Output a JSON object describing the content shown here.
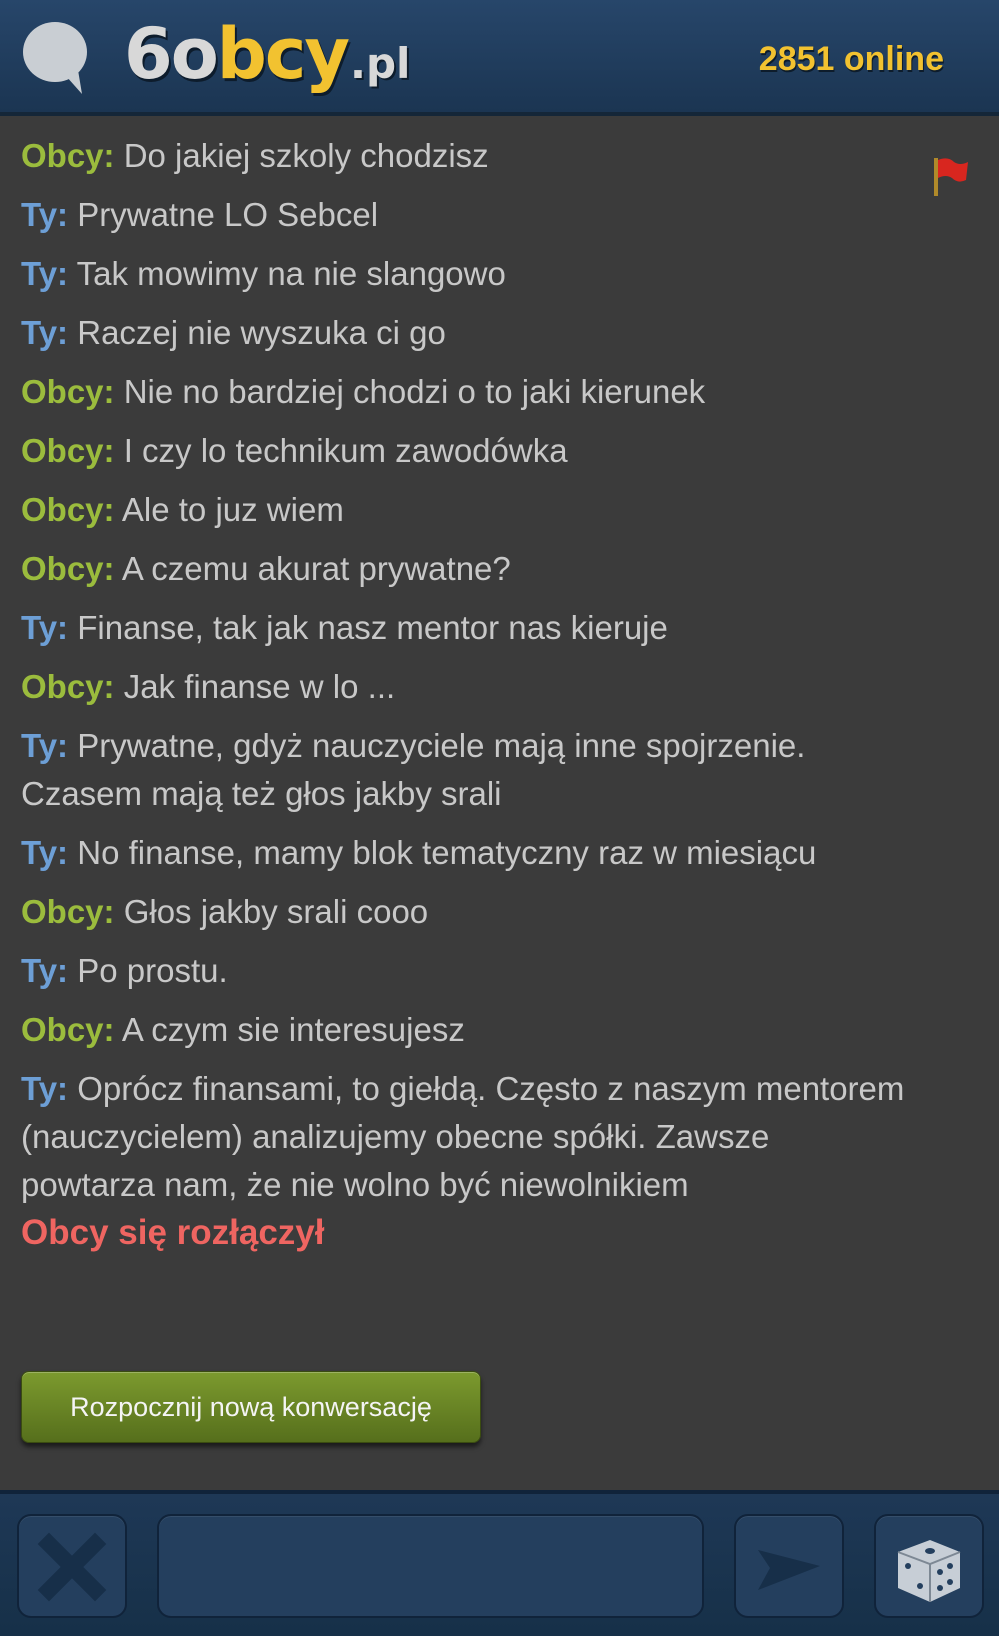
{
  "header": {
    "logo_main": "6obcy",
    "logo_suffix": ".pl",
    "online_count": "2851 online"
  },
  "messages": [
    {
      "sender": "Obcy:",
      "text": "Do jakiej szkoly chodzisz",
      "type": "obcy"
    },
    {
      "sender": "Ty:",
      "text": "Prywatne LO Sebcel",
      "type": "ty"
    },
    {
      "sender": "Ty:",
      "text": "Tak mowimy na nie slangowo",
      "type": "ty"
    },
    {
      "sender": "Ty:",
      "text": "Raczej nie wyszuka ci go",
      "type": "ty"
    },
    {
      "sender": "Obcy:",
      "text": "Nie no bardziej chodzi o to jaki kierunek",
      "type": "obcy"
    },
    {
      "sender": "Obcy:",
      "text": "I czy lo technikum zawodówka",
      "type": "obcy"
    },
    {
      "sender": "Obcy:",
      "text": "Ale to juz wiem",
      "type": "obcy"
    },
    {
      "sender": "Obcy:",
      "text": "A czemu akurat prywatne?",
      "type": "obcy"
    },
    {
      "sender": "Ty:",
      "text": "Finanse, tak jak nasz mentor nas kieruje",
      "type": "ty"
    },
    {
      "sender": "Obcy:",
      "text": "Jak finanse w lo ...",
      "type": "obcy"
    },
    {
      "sender": "Ty:",
      "text": "Prywatne, gdyż nauczyciele mają inne spojrzenie. Czasem mają też głos jakby srali",
      "type": "ty"
    },
    {
      "sender": "Ty:",
      "text": "No finanse, mamy blok tematyczny raz w miesiącu",
      "type": "ty"
    },
    {
      "sender": "Obcy:",
      "text": "Głos jakby srali cooo",
      "type": "obcy"
    },
    {
      "sender": "Ty:",
      "text": "Po prostu.",
      "type": "ty"
    },
    {
      "sender": "Obcy:",
      "text": "A czym sie interesujesz",
      "type": "obcy"
    },
    {
      "sender": "Ty:",
      "text": "Oprócz finansami, to giełdą. Często z naszym mentorem (nauczycielem) analizujemy obecne spółki. Zawsze powtarza nam, że nie wolno być niewolnikiem",
      "type": "ty"
    }
  ],
  "status": {
    "disconnected": "Obcy się rozłączył"
  },
  "actions": {
    "new_conversation": "Rozpocznij nową konwersację"
  },
  "footer": {
    "message_input_placeholder": "",
    "icons": [
      "close-icon",
      "send-icon",
      "dice-icon"
    ]
  },
  "colors": {
    "header_bg": "#1f3b5c",
    "accent_yellow": "#f2c230",
    "obcy_green": "#9bbc3d",
    "ty_blue": "#6d9fd6",
    "disconnect_red": "#ef6561",
    "chat_bg": "#3b3b3b"
  }
}
